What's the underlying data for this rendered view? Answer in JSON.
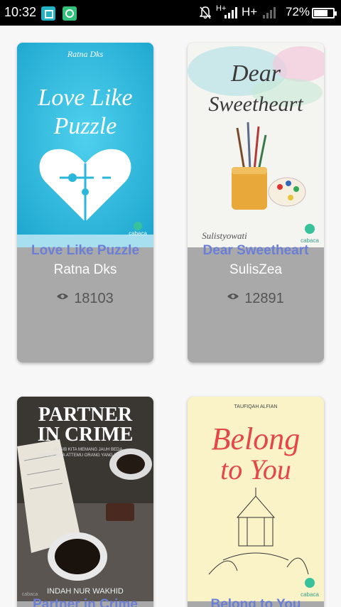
{
  "status_bar": {
    "time": "10:32",
    "network_mini": "H+",
    "network_type": "H+",
    "battery_text": "72%",
    "battery_level": 0.72
  },
  "books": [
    {
      "title": "Love Like Puzzle",
      "author": "Ratna Dks",
      "views": "18103",
      "cover": {
        "author": "Ratna Dks",
        "line1": "Love Like",
        "line2": "Puzzle",
        "logo": "cabaca",
        "bg": "#2bb7d9"
      }
    },
    {
      "title": "Dear Sweetheart",
      "author": "SulisZea",
      "views": "12891",
      "cover": {
        "line1": "Dear",
        "line2": "Sweetheart",
        "signature": "Sulistyowati",
        "logo": "cabaca",
        "bg": "#f4f4f0"
      }
    },
    {
      "title": "Partner in Crime",
      "author": "",
      "views": "",
      "cover": {
        "line1": "PARTNER",
        "line2": "IN CRIME",
        "tagline1": "\"NASIB KITA MEMANG JAUH BEDA,",
        "tagline2": "NGGAK BISA ATTEMU ORANG YANG KITA SUKA\"",
        "author": "INDAH NUR WAKHID",
        "logo": "cabaca",
        "bg": "#3a3733"
      }
    },
    {
      "title": "Belong to You",
      "author": "",
      "views": "",
      "cover": {
        "author": "TAUFIQAH ALFIAN",
        "line1": "Belong",
        "line2": "to You",
        "logo": "cabaca",
        "bg": "#fbf3c8"
      }
    }
  ],
  "colors": {
    "title": "#6b7fd6",
    "card_bg": "#a9a9a9",
    "status_bg": "#000000"
  },
  "icons": {
    "views": "eye-icon",
    "status_apps": [
      "screenshot-icon",
      "hotspot-icon"
    ]
  }
}
